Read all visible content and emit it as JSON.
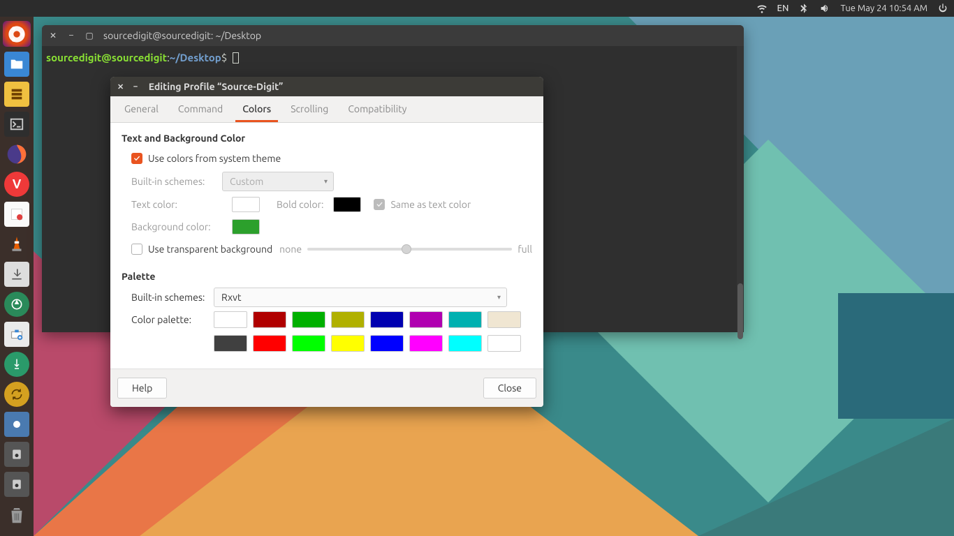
{
  "top_bar": {
    "lang": "EN",
    "datetime": "Tue May 24 10:54 AM"
  },
  "terminal": {
    "title": "sourcedigit@sourcedigit: ~/Desktop",
    "prompt_user": "sourcedigit@sourcedigit",
    "prompt_colon": ":",
    "prompt_path": "~/Desktop",
    "prompt_dollar": "$"
  },
  "dialog": {
    "title": "Editing Profile “Source-Digit”",
    "tabs": {
      "general": "General",
      "command": "Command",
      "colors": "Colors",
      "scrolling": "Scrolling",
      "compat": "Compatibility"
    },
    "section1_title": "Text and Background Color",
    "use_system_theme": "Use colors from system theme",
    "builtin_schemes_label": "Built-in schemes:",
    "builtin_schemes_value": "Custom",
    "text_color_label": "Text color:",
    "bold_color_label": "Bold color:",
    "same_as_text": "Same as text color",
    "bg_color_label": "Background color:",
    "use_transparent": "Use transparent background",
    "slider_none": "none",
    "slider_full": "full",
    "section2_title": "Palette",
    "palette_schemes_label": "Built-in schemes:",
    "palette_schemes_value": "Rxvt",
    "color_palette_label": "Color palette:",
    "help": "Help",
    "close": "Close",
    "colors": {
      "text": "#ffffff",
      "bold": "#000000",
      "bg": "#2ca02c",
      "palette": [
        "#ffffff",
        "#b00000",
        "#00b000",
        "#b0b000",
        "#0000b0",
        "#b000b0",
        "#00b0b0",
        "#f0e6d2",
        "#404040",
        "#ff0000",
        "#00ff00",
        "#ffff00",
        "#0000ff",
        "#ff00ff",
        "#00ffff",
        "#ffffff"
      ]
    }
  }
}
